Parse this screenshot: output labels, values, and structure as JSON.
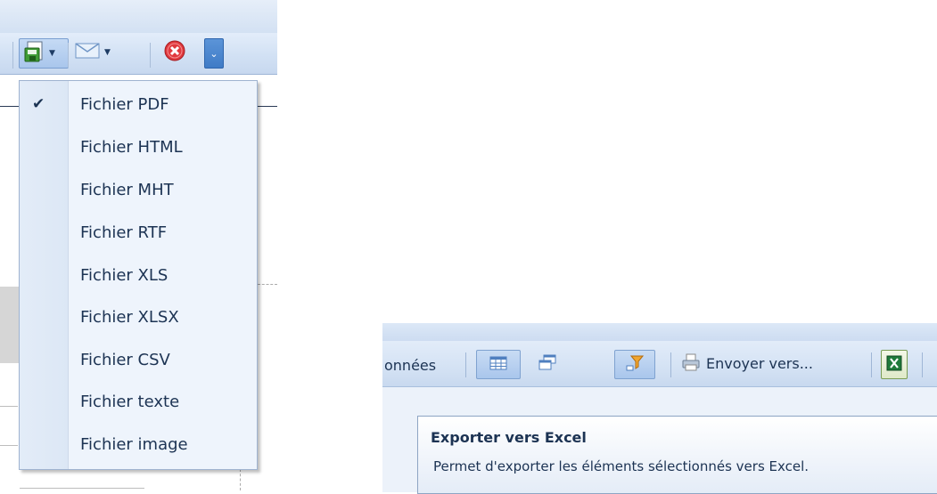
{
  "export_menu": {
    "items": [
      {
        "label": "Fichier PDF",
        "checked": true
      },
      {
        "label": "Fichier HTML",
        "checked": false
      },
      {
        "label": "Fichier MHT",
        "checked": false
      },
      {
        "label": "Fichier RTF",
        "checked": false
      },
      {
        "label": "Fichier XLS",
        "checked": false
      },
      {
        "label": "Fichier XLSX",
        "checked": false
      },
      {
        "label": "Fichier CSV",
        "checked": false
      },
      {
        "label": "Fichier texte",
        "checked": false
      },
      {
        "label": "Fichier image",
        "checked": false
      }
    ],
    "check_glyph": "✔"
  },
  "toolbar_icons": [
    "save-export-icon",
    "email-icon",
    "close-red-icon",
    "dropdown-chevron-icon"
  ],
  "excel_panel": {
    "partial_label": "onnées",
    "send_to_label": "Envoyer vers...",
    "tooltip": {
      "title": "Exporter vers Excel",
      "description": "Permet d'exporter les éléments sélectionnés vers Excel."
    }
  },
  "colors": {
    "toolbar_blue": "#d2e1f4",
    "menu_bg": "#eef4fc",
    "text": "#1c3353",
    "close_red": "#e0393e",
    "excel_green": "#1f7a3a"
  }
}
